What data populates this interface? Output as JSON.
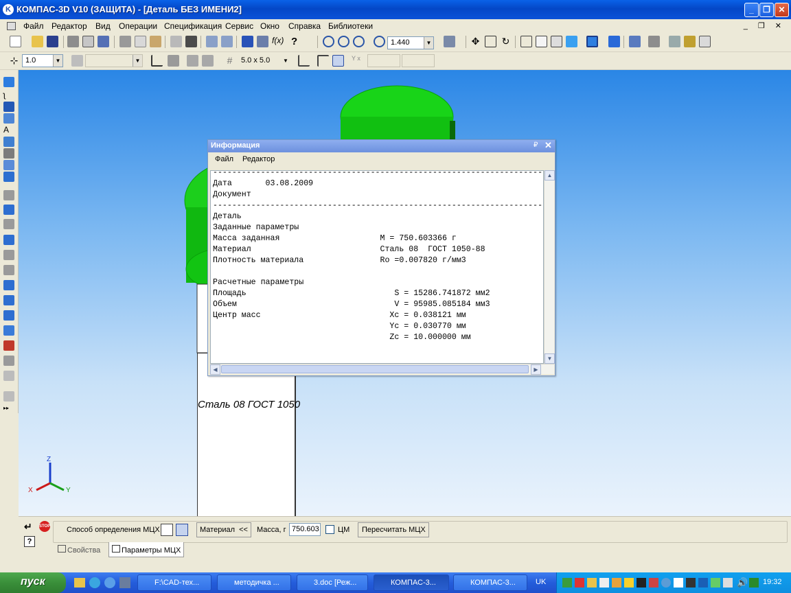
{
  "window": {
    "title": "КОМПАС-3D V10 (ЗАЩИТА) - [Деталь БЕЗ ИМЕНИ2]",
    "minimize": "_",
    "maximize": "❐",
    "close": "✕"
  },
  "menu": {
    "items": [
      "Файл",
      "Редактор",
      "Вид",
      "Операции",
      "Спецификация",
      "Сервис",
      "Окно",
      "Справка",
      "Библиотеки"
    ],
    "doc_controls": "_ ❐ ✕"
  },
  "toolbar1": {
    "zoom_value": "1.440",
    "fx_label": "f(x)",
    "help_label": "?"
  },
  "toolbar2": {
    "step_value": "1.0",
    "grid_value": "5.0 x 5.0",
    "coord_label": "Y x"
  },
  "info_window": {
    "title": "Информация",
    "pin": "₽",
    "close": "✕",
    "menu": [
      "Файл",
      "Редактор"
    ],
    "lines": [
      "----------------------------------------------------------------------",
      "Дата       03.08.2009",
      "Документ",
      "----------------------------------------------------------------------",
      "Деталь",
      "Заданные параметры",
      "Масса заданная                     M = 750.603366 г",
      "Материал                           Сталь 08  ГОСТ 1050-88",
      "Плотность материала                Ro =0.007820 г/мм3",
      "",
      "Расчетные параметры",
      "Площадь                               S = 15286.741872 мм2",
      "Объем                                 V = 95985.085184 мм3",
      "Центр масс                           Xc = 0.038121 мм",
      "                                     Yc = 0.030770 мм",
      "                                     Zc = 10.000000 мм"
    ]
  },
  "material_panel": {
    "text": "Сталь 08  ГОСТ 1050"
  },
  "axes": {
    "z": "Z",
    "x": "X",
    "y": "Y"
  },
  "property_panel": {
    "method_label": "Способ определения МЦХ",
    "material_button": "Материал  <<",
    "mass_label": "Масса, г",
    "mass_value": "750.603",
    "cm_label": "ЦМ",
    "recalc_button": "Пересчитать МЦХ",
    "tabs": [
      "Свойства",
      "Параметры МЦХ"
    ]
  },
  "taskbar": {
    "start": "пуск",
    "tasks": [
      "F:\\CAD-тех...",
      "методичка ...",
      "3.doc [Реж...",
      "КОМПАС-3...",
      "КОМПАС-3..."
    ],
    "lang": "UK",
    "clock": "19:32"
  }
}
